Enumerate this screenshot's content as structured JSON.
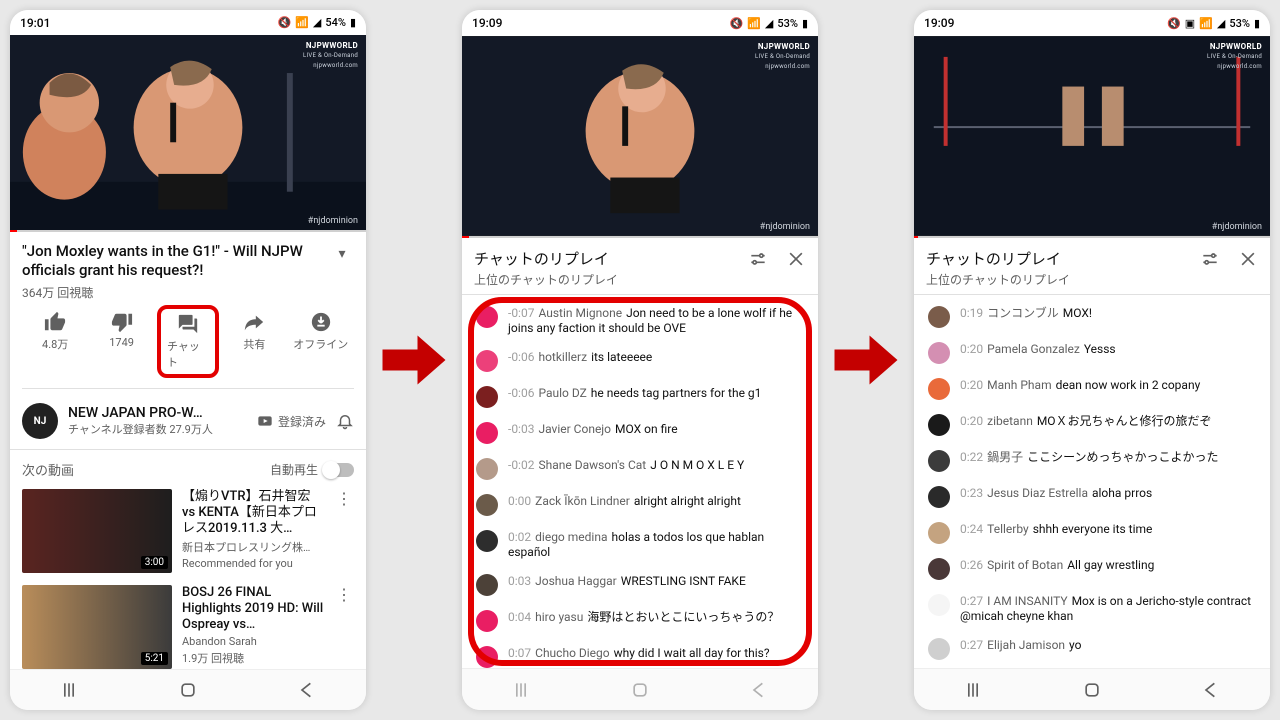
{
  "watermark": {
    "brand": "NJPWWORLD",
    "sub": "LIVE & On-Demand",
    "url": "njpwworld.com",
    "hashtag": "#njdominion"
  },
  "phone1": {
    "status": {
      "time": "19:01",
      "battery": "54%"
    },
    "title": "\"Jon Moxley wants in the G1!\" - Will NJPW officials grant his request?!",
    "views": "364万 回視聴",
    "actions": {
      "like": "4.8万",
      "dislike": "1749",
      "chat": "チャット",
      "share": "共有",
      "offline": "オフライン"
    },
    "channel": {
      "name": "NEW JAPAN PRO-W…",
      "subs": "チャンネル登録者数 27.9万人",
      "subscribe": "登録済み",
      "avatar_text": "NJ"
    },
    "upnext": {
      "label": "次の動画",
      "autoplay": "自動再生"
    },
    "recs": [
      {
        "title": "【煽りVTR】石井智宏 vs KENTA【新日本プロレス2019.11.3 大…",
        "channel": "新日本プロレスリング株…",
        "subtext": "Recommended for you",
        "duration": "3:00",
        "colors": [
          "#5a2420",
          "#1e1e1e"
        ]
      },
      {
        "title": "BOSJ 26 FINAL Highlights 2019 HD: Will Ospreay vs…",
        "channel": "Abandon Sarah",
        "subtext": "1.9万 回視聴",
        "duration": "5:21",
        "colors": [
          "#b98d5a",
          "#3b3b3b"
        ]
      }
    ]
  },
  "phone2": {
    "status": {
      "time": "19:09",
      "battery": "53%"
    },
    "chat": {
      "title": "チャットのリプレイ",
      "subtitle": "上位のチャットのリプレイ"
    },
    "messages": [
      {
        "ts": "-0:07",
        "name": "Austin Mignone",
        "text": "Jon need to be a lone wolf if he joins any faction it should be OVE",
        "color": "#e91e63"
      },
      {
        "ts": "-0:06",
        "name": "hotkillerz",
        "text": "its lateeeee",
        "color": "#ec407a"
      },
      {
        "ts": "-0:06",
        "name": "Paulo DZ",
        "text": "he needs tag partners for the g1",
        "color": "#7b1f1f"
      },
      {
        "ts": "-0:03",
        "name": "Javier Conejo",
        "text": "MOX on fire",
        "color": "#e91e63"
      },
      {
        "ts": "-0:02",
        "name": "Shane Dawson's Cat",
        "text": "J O N M O X L E Y",
        "color": "#b49a8a"
      },
      {
        "ts": "0:00",
        "name": "Zack Īkōn Lindner",
        "text": "alright alright alright",
        "color": "#6b5b4a"
      },
      {
        "ts": "0:02",
        "name": "diego medina",
        "text": "holas a todos los que hablan español",
        "color": "#2d2d2d"
      },
      {
        "ts": "0:03",
        "name": "Joshua Haggar",
        "text": "WRESTLING ISNT FAKE",
        "color": "#4c4138"
      },
      {
        "ts": "0:04",
        "name": "hiro yasu",
        "text": "海野はとおいとこにいっちゃうの？",
        "color": "#e91e63"
      },
      {
        "ts": "0:07",
        "name": "Chucho Diego",
        "text": "why did I wait all day for this?",
        "color": "#e91e63"
      }
    ]
  },
  "phone3": {
    "status": {
      "time": "19:09",
      "battery": "53%"
    },
    "chat": {
      "title": "チャットのリプレイ",
      "subtitle": "上位のチャットのリプレイ"
    },
    "messages": [
      {
        "ts": "0:19",
        "name": "コンコンブル",
        "text": "MOX!",
        "color": "#7a5c4a"
      },
      {
        "ts": "0:20",
        "name": "Pamela Gonzalez",
        "text": "Yesss",
        "color": "#d48fb2"
      },
      {
        "ts": "0:20",
        "name": "Manh Pham",
        "text": "dean now work in 2 copany",
        "color": "#e96a3a"
      },
      {
        "ts": "0:20",
        "name": "zibetann",
        "text": "MOＸお兄ちゃんと修行の旅だぞ",
        "color": "#1a1a1a"
      },
      {
        "ts": "0:22",
        "name": "鍋男子",
        "text": "ここシーンめっちゃかっこよかった",
        "color": "#3b3b3b"
      },
      {
        "ts": "0:23",
        "name": "Jesus Diaz Estrella",
        "text": "aloha prros",
        "color": "#2a2a2a"
      },
      {
        "ts": "0:24",
        "name": "Tellerby",
        "text": "shhh everyone its time",
        "color": "#c4a380"
      },
      {
        "ts": "0:26",
        "name": "Spirit of Botan",
        "text": "All gay wrestling",
        "color": "#4a3838"
      },
      {
        "ts": "0:27",
        "name": "I AM INSANITY",
        "text": "Mox is on a Jericho-style contract @micah cheyne khan",
        "color": "#f5f5f5"
      },
      {
        "ts": "0:27",
        "name": "Elijah Jamison",
        "text": "yo",
        "color": "#cfcfcf"
      }
    ]
  }
}
